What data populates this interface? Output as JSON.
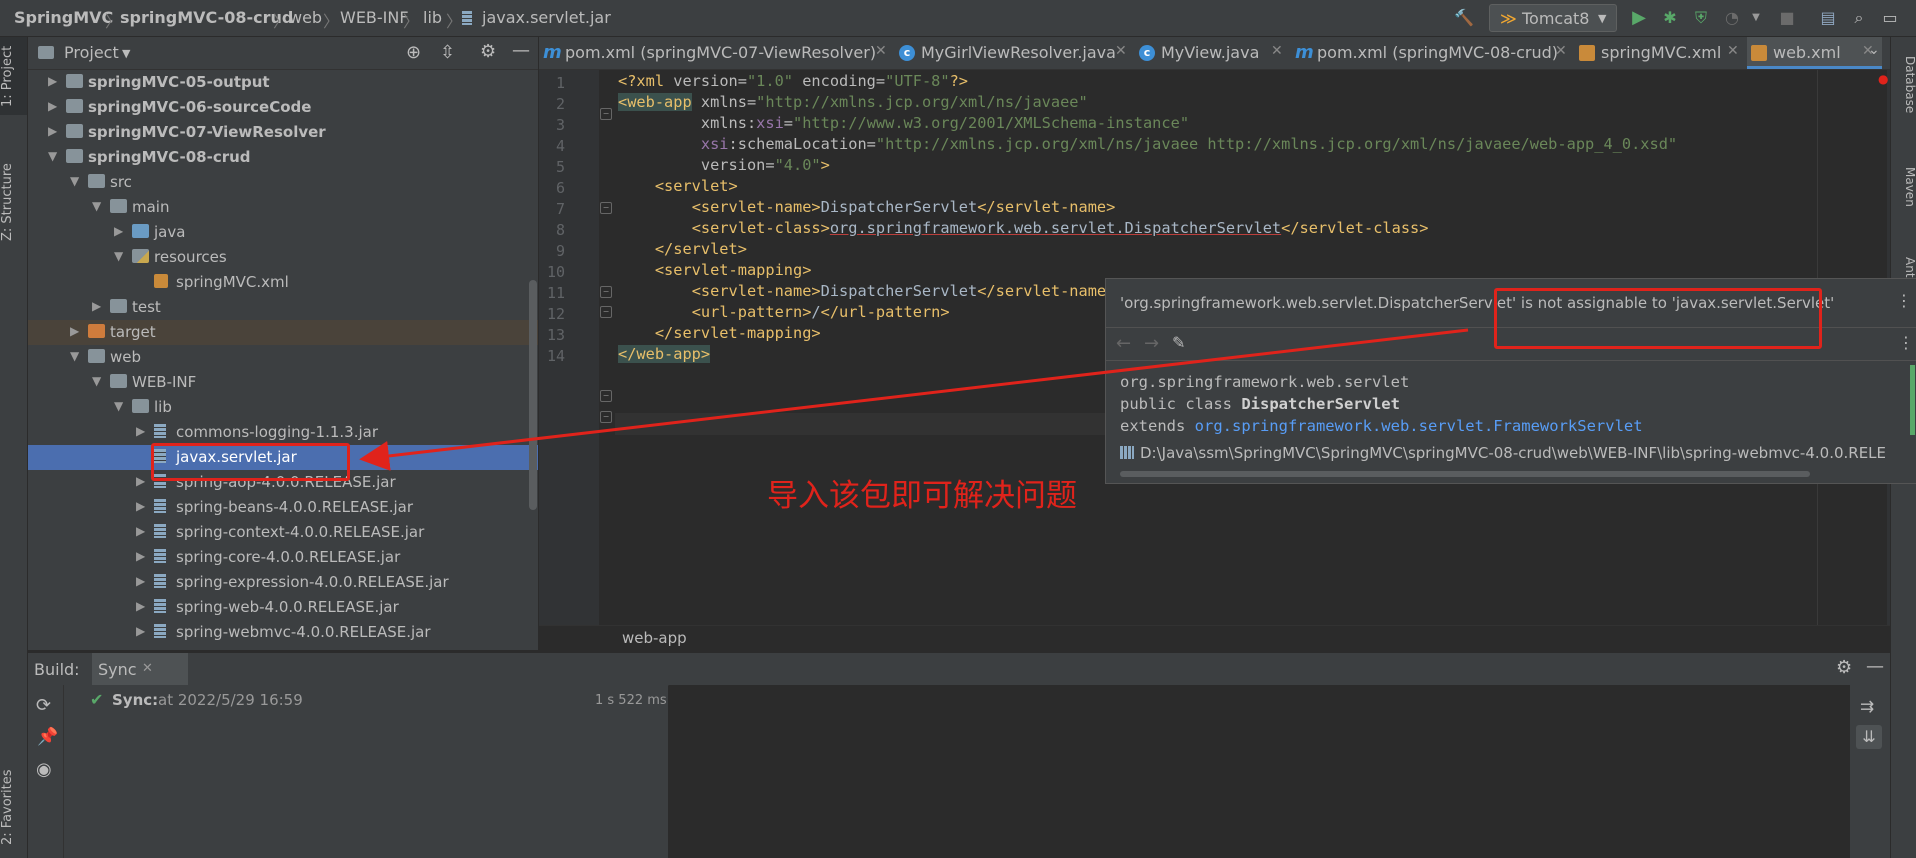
{
  "breadcrumb": [
    "SpringMVC",
    "springMVC-08-crud",
    "web",
    "WEB-INF",
    "lib",
    "javax.servlet.jar"
  ],
  "toolbar": {
    "run_config": "Tomcat8"
  },
  "left_tool_tabs": [
    "1: Project",
    "Z: Structure",
    "2: Favorites"
  ],
  "right_tool_tabs": [
    "Database",
    "Maven",
    "Ant"
  ],
  "project_panel": {
    "title": "Project",
    "tree": [
      {
        "label": "springMVC-05-output",
        "depth": 0,
        "arrow": "▶",
        "icon": "module",
        "bold": true
      },
      {
        "label": "springMVC-06-sourceCode",
        "depth": 0,
        "arrow": "▶",
        "icon": "module",
        "bold": true
      },
      {
        "label": "springMVC-07-ViewResolver",
        "depth": 0,
        "arrow": "▶",
        "icon": "module",
        "bold": true
      },
      {
        "label": "springMVC-08-crud",
        "depth": 0,
        "arrow": "▼",
        "icon": "module",
        "bold": true
      },
      {
        "label": "src",
        "depth": 1,
        "arrow": "▼",
        "icon": "folder"
      },
      {
        "label": "main",
        "depth": 2,
        "arrow": "▼",
        "icon": "folder"
      },
      {
        "label": "java",
        "depth": 3,
        "arrow": "▶",
        "icon": "folder-blue"
      },
      {
        "label": "resources",
        "depth": 3,
        "arrow": "▼",
        "icon": "folder-res"
      },
      {
        "label": "springMVC.xml",
        "depth": 4,
        "arrow": "",
        "icon": "xml"
      },
      {
        "label": "test",
        "depth": 2,
        "arrow": "▶",
        "icon": "folder"
      },
      {
        "label": "target",
        "depth": 1,
        "arrow": "▶",
        "icon": "folder-orange",
        "excluded": true
      },
      {
        "label": "web",
        "depth": 1,
        "arrow": "▼",
        "icon": "folder"
      },
      {
        "label": "WEB-INF",
        "depth": 2,
        "arrow": "▼",
        "icon": "folder"
      },
      {
        "label": "lib",
        "depth": 3,
        "arrow": "▼",
        "icon": "folder"
      },
      {
        "label": "commons-logging-1.1.3.jar",
        "depth": 4,
        "arrow": "▶",
        "icon": "jar"
      },
      {
        "label": "javax.servlet.jar",
        "depth": 4,
        "arrow": "",
        "icon": "jar",
        "selected": true
      },
      {
        "label": "spring-aop-4.0.0.RELEASE.jar",
        "depth": 4,
        "arrow": "▶",
        "icon": "jar"
      },
      {
        "label": "spring-beans-4.0.0.RELEASE.jar",
        "depth": 4,
        "arrow": "▶",
        "icon": "jar"
      },
      {
        "label": "spring-context-4.0.0.RELEASE.jar",
        "depth": 4,
        "arrow": "▶",
        "icon": "jar"
      },
      {
        "label": "spring-core-4.0.0.RELEASE.jar",
        "depth": 4,
        "arrow": "▶",
        "icon": "jar"
      },
      {
        "label": "spring-expression-4.0.0.RELEASE.jar",
        "depth": 4,
        "arrow": "▶",
        "icon": "jar"
      },
      {
        "label": "spring-web-4.0.0.RELEASE.jar",
        "depth": 4,
        "arrow": "▶",
        "icon": "jar"
      },
      {
        "label": "spring-webmvc-4.0.0.RELEASE.jar",
        "depth": 4,
        "arrow": "▶",
        "icon": "jar"
      }
    ]
  },
  "editor_tabs": [
    {
      "label": "pom.xml (springMVC-07-ViewResolver)",
      "icon": "m"
    },
    {
      "label": "MyGirlViewResolver.java",
      "icon": "c"
    },
    {
      "label": "MyView.java",
      "icon": "c"
    },
    {
      "label": "pom.xml (springMVC-08-crud)",
      "icon": "m"
    },
    {
      "label": "springMVC.xml",
      "icon": "x"
    },
    {
      "label": "web.xml",
      "icon": "x",
      "active": true
    }
  ],
  "editor": {
    "line_numbers": [
      "1",
      "2",
      "3",
      "4",
      "5",
      "6",
      "7",
      "8",
      "9",
      "10",
      "11",
      "12",
      "13",
      "14"
    ],
    "breadcrumb": "web-app"
  },
  "popup": {
    "error_prefix": "'org.springframework.web.servlet.DispatcherServlet'",
    "error_suffix": " is not assignable to 'javax.servlet.Servlet'",
    "doc_package": "org.springframework.web.servlet",
    "doc_decl_prefix": "public class ",
    "doc_class": "DispatcherServlet",
    "doc_extends": "extends ",
    "doc_super": "org.springframework.web.servlet.FrameworkServlet",
    "doc_path": "D:\\Java\\ssm\\SpringMVC\\SpringMVC\\springMVC-08-crud\\web\\WEB-INF\\lib\\spring-webmvc-4.0.0.RELE"
  },
  "annotation": {
    "text": "导入该包即可解决问题",
    "color": "#e0231b"
  },
  "build_panel": {
    "title": "Build:",
    "tab": "Sync",
    "status_label": "Sync:",
    "status_time": "at 2022/5/29 16:59",
    "duration": "1 s 522 ms"
  },
  "colors": {
    "tag": "#e8bf6a",
    "attr_value": "#6a8759",
    "namespace": "#9876aa",
    "selection": "#4b6eaf",
    "annotation_red": "#e0231b",
    "link": "#589df6"
  }
}
